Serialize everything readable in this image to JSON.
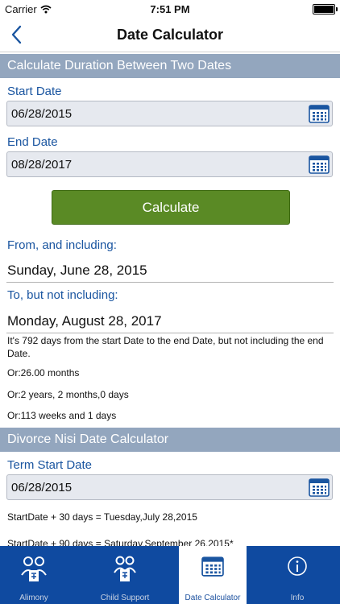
{
  "status": {
    "carrier": "Carrier",
    "time": "7:51 PM"
  },
  "nav": {
    "title": "Date Calculator"
  },
  "duration": {
    "header": "Calculate Duration Between Two Dates",
    "start_label": "Start Date",
    "start_value": "06/28/2015",
    "end_label": "End Date",
    "end_value": "08/28/2017",
    "calculate_label": "Calculate",
    "from_label": "From, and including:",
    "from_value": "Sunday, June 28, 2015",
    "to_label": "To, but not including:",
    "to_value": "Monday, August 28, 2017",
    "summary": "It's 792 days from the start Date to the end Date, but not including the end Date.",
    "months": "Or:26.00 months",
    "ymd": "Or:2 years, 2 months,0 days",
    "weeks": "Or:113 weeks and 1 days"
  },
  "divorce": {
    "header": "Divorce Nisi Date Calculator",
    "term_label": "Term Start Date",
    "term_value": "06/28/2015",
    "plus30": "StartDate + 30 days = Tuesday,July 28,2015",
    "plus90": "StartDate + 90 days = Saturday,September 26,2015*"
  },
  "tabs": [
    {
      "label": "Alimony"
    },
    {
      "label": "Child Support"
    },
    {
      "label": "Date Calculator"
    },
    {
      "label": "Info"
    }
  ],
  "colors": {
    "accent": "#1a55a0",
    "section_header": "#93a6be",
    "calculate_button": "#5a8a25",
    "tabbar": "#0f4aa0"
  }
}
